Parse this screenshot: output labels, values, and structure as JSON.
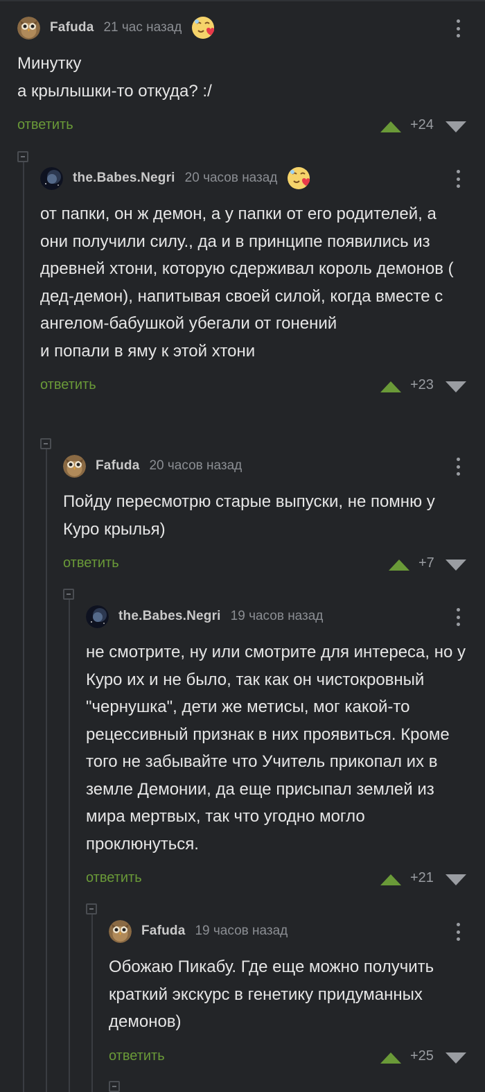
{
  "comments": [
    {
      "author": "Fafuda",
      "time": "21 час назад",
      "text": "Минутку\nа крылышки-то откуда? :/",
      "reply": "ответить",
      "score": "+24",
      "avatar": "owl-avatar",
      "badge": "heart-emoji-badge"
    },
    {
      "author": "the.Babes.Negri",
      "time": "20 часов назад",
      "text": "от папки, он ж демон, а у папки от его родителей, а они получили силу., да и в принципе появились из древней хтони, которую сдерживал король демонов ( дед-демон), напитывая своей силой, когда вместе с ангелом-бабушкой убегали от гонений\nи попали в яму к этой хтони",
      "reply": "ответить",
      "score": "+23",
      "avatar": "space-avatar",
      "badge": "heart-emoji-badge"
    },
    {
      "author": "Fafuda",
      "time": "20 часов назад",
      "text": "Пойду пересмотрю старые выпуски, не помню у Куро крылья)",
      "reply": "ответить",
      "score": "+7",
      "avatar": "owl-avatar"
    },
    {
      "author": "the.Babes.Negri",
      "time": "19 часов назад",
      "text": "не смотрите, ну или смотрите для интереса, но у Куро их и не было, так как он чистокровный \"чернушка\", дети же метисы, мог какой-то рецессивный признак в них проявиться. Кроме того не забывайте что Учитель прикопал их в земле Демонии, да еще присыпал землей из мира мертвых, так что угодно могло проклюнуться.",
      "reply": "ответить",
      "score": "+21",
      "avatar": "space-avatar"
    },
    {
      "author": "Fafuda",
      "time": "19 часов назад",
      "text": "Обожаю Пикабу. Где еще можно получить краткий экскурс в генетику придуманных демонов)",
      "reply": "ответить",
      "score": "+25",
      "avatar": "owl-avatar"
    }
  ],
  "colors": {
    "background": "#232528",
    "reply": "#6a9a38",
    "upvote": "#6a9a38",
    "muted": "#8b8e93"
  }
}
